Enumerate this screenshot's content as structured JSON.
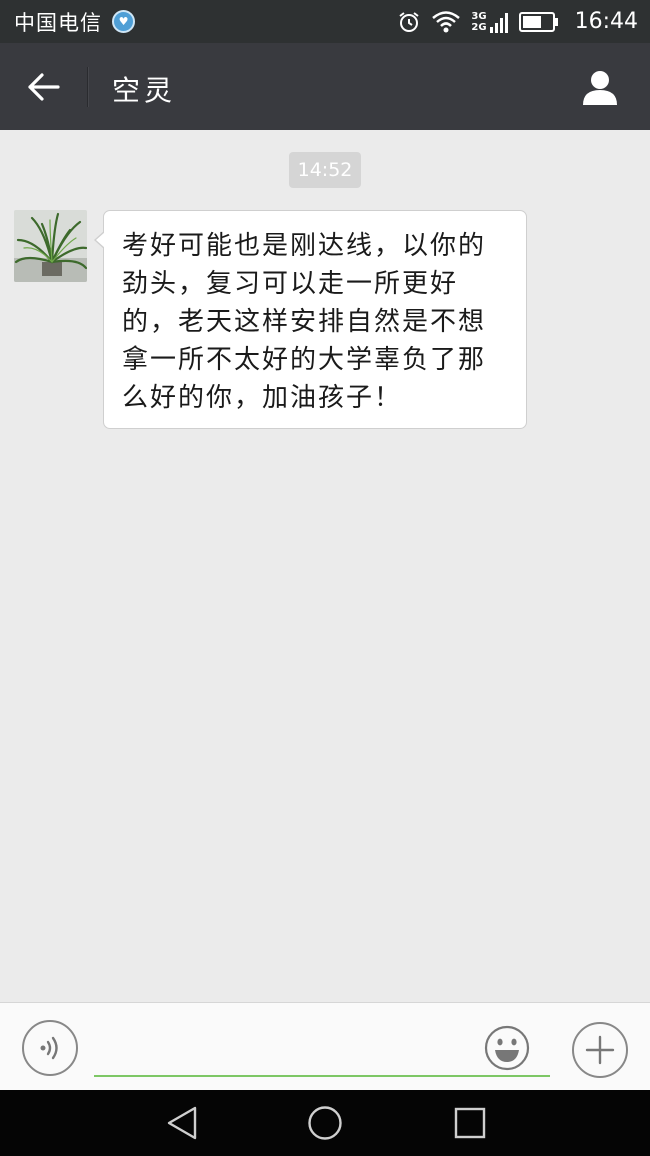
{
  "status_bar": {
    "carrier": "中国电信",
    "network_label_top": "3G",
    "network_label_bottom": "2G",
    "time": "16:44",
    "icons": [
      "carrier-badge-icon",
      "alarm-icon",
      "wifi-icon",
      "signal-icon",
      "battery-icon"
    ]
  },
  "header": {
    "title": "空灵",
    "back_icon": "arrow-left-icon",
    "profile_icon": "person-icon"
  },
  "chat": {
    "timestamp": "14:52",
    "messages": [
      {
        "sender": "other",
        "text": "考好可能也是刚达线，以你的劲头，复习可以走一所更好的，老天这样安排自然是不想拿一所不太好的大学辜负了那么好的你，加油孩子！"
      }
    ]
  },
  "input_bar": {
    "value": "",
    "placeholder": "",
    "icons": [
      "voice-icon",
      "emoji-icon",
      "plus-icon"
    ]
  },
  "nav_bar": {
    "icons": [
      "back-triangle-icon",
      "home-circle-icon",
      "recents-square-icon"
    ]
  },
  "colors": {
    "status_bar": "#2e3132",
    "title_bar": "#393a3f",
    "chat_background": "#ebebeb",
    "input_underline": "#7dc765",
    "nav_bar": "#050505"
  }
}
